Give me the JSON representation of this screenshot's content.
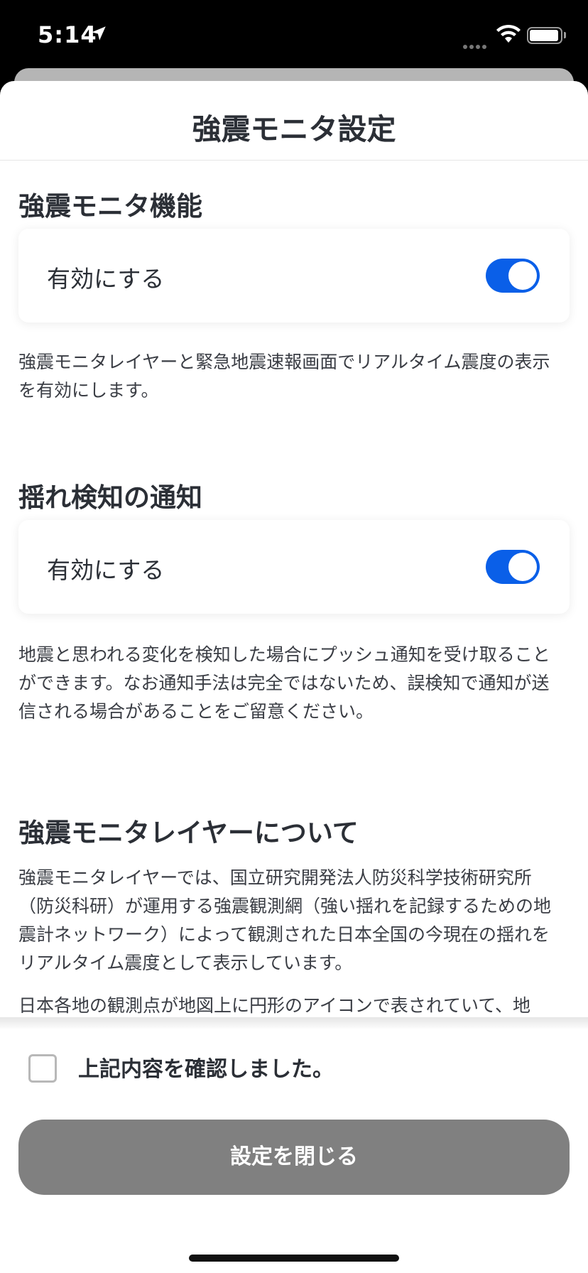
{
  "status_bar": {
    "time": "5:14"
  },
  "sheet": {
    "title": "強震モニタ設定"
  },
  "sections": {
    "monitor": {
      "heading": "強震モニタ機能",
      "toggle_label": "有効にする",
      "toggle_on": true,
      "description": "強震モニタレイヤーと緊急地震速報画面でリアルタイム震度の表示を有効にします。"
    },
    "shake_notify": {
      "heading": "揺れ検知の通知",
      "toggle_label": "有効にする",
      "toggle_on": true,
      "description": "地震と思われる変化を検知した場合にプッシュ通知を受け取ることができます。なお通知手法は完全ではないため、誤検知で通知が送信される場合があることをご留意ください。"
    },
    "about": {
      "heading": "強震モニタレイヤーについて",
      "paragraph1": "強震モニタレイヤーでは、国立研究開発法人防災科学技術研究所（防災科研）が運用する強震観測網（強い揺れを記録するための地震計ネットワーク）によって観測された日本全国の今現在の揺れをリアルタイム震度として表示しています。",
      "paragraph2": "日本各地の観測点が地図上に円形のアイコンで表されていて、地"
    }
  },
  "footer": {
    "confirm_label": "上記内容を確認しました。",
    "confirm_checked": false,
    "close_button": "設定を閉じる"
  },
  "colors": {
    "accent": "#0a5fe8",
    "text": "#2b2f36",
    "button_disabled": "#808080"
  }
}
